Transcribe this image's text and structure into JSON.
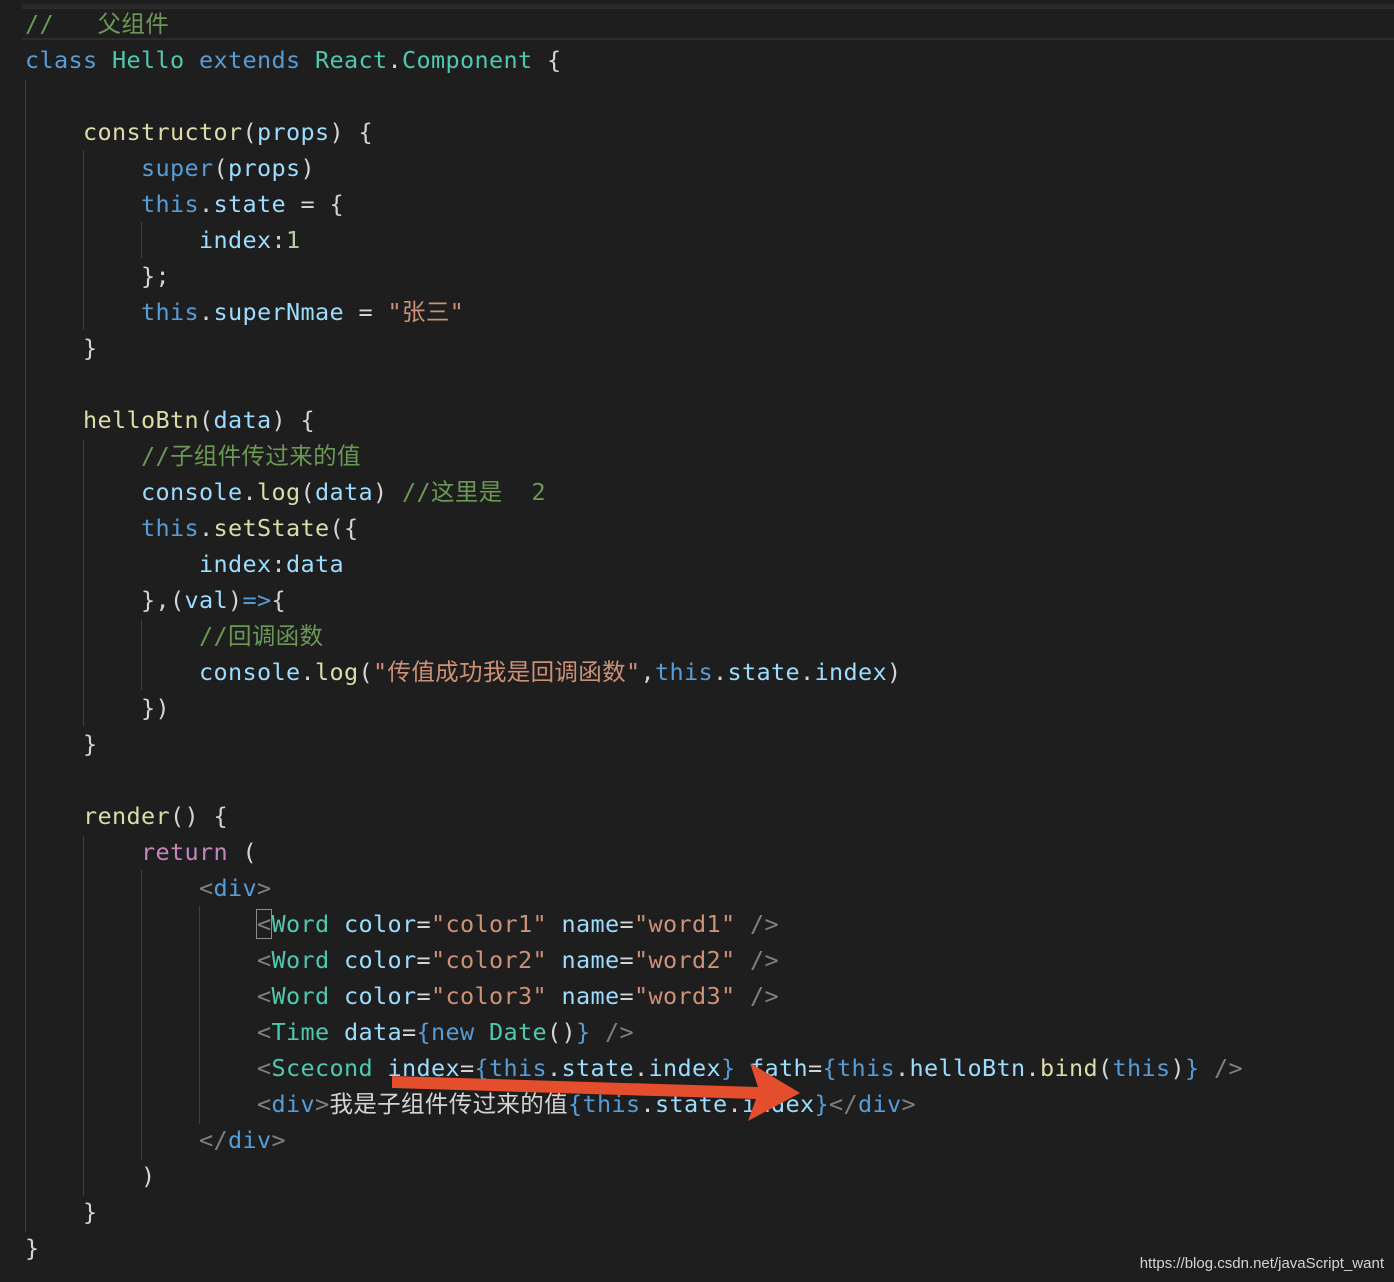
{
  "colors": {
    "background": "#1e1e1e",
    "arrow": "#e54e2c",
    "keyword": "#569cd6",
    "control": "#c586c0",
    "type": "#4ec9b0",
    "function": "#dcdcaa",
    "variable": "#9cdcfe",
    "string": "#ce9178",
    "number": "#b5cea8",
    "comment": "#6a9955",
    "plain": "#d4d4d4",
    "tag_punct": "#808080"
  },
  "watermark": "https://blog.csdn.net/javaScript_want",
  "annotation": {
    "icon": "red-arrow-icon"
  },
  "code_lines": [
    [
      [
        "c",
        "//   父组件"
      ]
    ],
    [
      [
        "k",
        "class"
      ],
      [
        "p",
        " "
      ],
      [
        "t",
        "Hello"
      ],
      [
        "p",
        " "
      ],
      [
        "k",
        "extends"
      ],
      [
        "p",
        " "
      ],
      [
        "t",
        "React"
      ],
      [
        "p",
        "."
      ],
      [
        "t",
        "Component"
      ],
      [
        "p",
        " {"
      ]
    ],
    [],
    [
      [
        "p",
        "    "
      ],
      [
        "f",
        "constructor"
      ],
      [
        "p",
        "("
      ],
      [
        "v",
        "props"
      ],
      [
        "p",
        ") {"
      ]
    ],
    [
      [
        "p",
        "        "
      ],
      [
        "k",
        "super"
      ],
      [
        "p",
        "("
      ],
      [
        "v",
        "props"
      ],
      [
        "p",
        ")"
      ]
    ],
    [
      [
        "p",
        "        "
      ],
      [
        "k",
        "this"
      ],
      [
        "p",
        "."
      ],
      [
        "v",
        "state"
      ],
      [
        "p",
        " = {"
      ]
    ],
    [
      [
        "p",
        "            "
      ],
      [
        "v",
        "index"
      ],
      [
        "p",
        ":"
      ],
      [
        "n",
        "1"
      ]
    ],
    [
      [
        "p",
        "        };"
      ]
    ],
    [
      [
        "p",
        "        "
      ],
      [
        "k",
        "this"
      ],
      [
        "p",
        "."
      ],
      [
        "v",
        "superNmae"
      ],
      [
        "p",
        " = "
      ],
      [
        "s",
        "\"张三\""
      ]
    ],
    [
      [
        "p",
        "    }"
      ]
    ],
    [],
    [
      [
        "p",
        "    "
      ],
      [
        "f",
        "helloBtn"
      ],
      [
        "p",
        "("
      ],
      [
        "v",
        "data"
      ],
      [
        "p",
        ") {"
      ]
    ],
    [
      [
        "p",
        "        "
      ],
      [
        "c",
        "//子组件传过来的值"
      ]
    ],
    [
      [
        "p",
        "        "
      ],
      [
        "v",
        "console"
      ],
      [
        "p",
        "."
      ],
      [
        "f",
        "log"
      ],
      [
        "p",
        "("
      ],
      [
        "v",
        "data"
      ],
      [
        "p",
        ") "
      ],
      [
        "c",
        "//这里是  2"
      ]
    ],
    [
      [
        "p",
        "        "
      ],
      [
        "k",
        "this"
      ],
      [
        "p",
        "."
      ],
      [
        "f",
        "setState"
      ],
      [
        "p",
        "({"
      ]
    ],
    [
      [
        "p",
        "            "
      ],
      [
        "v",
        "index"
      ],
      [
        "p",
        ":"
      ],
      [
        "v",
        "data"
      ]
    ],
    [
      [
        "p",
        "        },("
      ],
      [
        "v",
        "val"
      ],
      [
        "p",
        ")"
      ],
      [
        "k",
        "=>"
      ],
      [
        "p",
        "{"
      ]
    ],
    [
      [
        "p",
        "            "
      ],
      [
        "c",
        "//回调函数"
      ]
    ],
    [
      [
        "p",
        "            "
      ],
      [
        "v",
        "console"
      ],
      [
        "p",
        "."
      ],
      [
        "f",
        "log"
      ],
      [
        "p",
        "("
      ],
      [
        "s",
        "\"传值成功我是回调函数\""
      ],
      [
        "p",
        ","
      ],
      [
        "k",
        "this"
      ],
      [
        "p",
        "."
      ],
      [
        "v",
        "state"
      ],
      [
        "p",
        "."
      ],
      [
        "v",
        "index"
      ],
      [
        "p",
        ")"
      ]
    ],
    [
      [
        "p",
        "        })"
      ]
    ],
    [
      [
        "p",
        "    }"
      ]
    ],
    [],
    [
      [
        "p",
        "    "
      ],
      [
        "f",
        "render"
      ],
      [
        "p",
        "() {"
      ]
    ],
    [
      [
        "p",
        "        "
      ],
      [
        "r",
        "return"
      ],
      [
        "p",
        " ("
      ]
    ],
    [
      [
        "p",
        "            "
      ],
      [
        "g",
        "<"
      ],
      [
        "k",
        "div"
      ],
      [
        "g",
        ">"
      ]
    ],
    [
      [
        "p",
        "                "
      ],
      [
        "g",
        "<"
      ],
      [
        "t",
        "Word"
      ],
      [
        "p",
        " "
      ],
      [
        "v",
        "color"
      ],
      [
        "p",
        "="
      ],
      [
        "s",
        "\"color1\""
      ],
      [
        "p",
        " "
      ],
      [
        "v",
        "name"
      ],
      [
        "p",
        "="
      ],
      [
        "s",
        "\"word1\""
      ],
      [
        "p",
        " "
      ],
      [
        "g",
        "/>"
      ]
    ],
    [
      [
        "p",
        "                "
      ],
      [
        "g",
        "<"
      ],
      [
        "t",
        "Word"
      ],
      [
        "p",
        " "
      ],
      [
        "v",
        "color"
      ],
      [
        "p",
        "="
      ],
      [
        "s",
        "\"color2\""
      ],
      [
        "p",
        " "
      ],
      [
        "v",
        "name"
      ],
      [
        "p",
        "="
      ],
      [
        "s",
        "\"word2\""
      ],
      [
        "p",
        " "
      ],
      [
        "g",
        "/>"
      ]
    ],
    [
      [
        "p",
        "                "
      ],
      [
        "g",
        "<"
      ],
      [
        "t",
        "Word"
      ],
      [
        "p",
        " "
      ],
      [
        "v",
        "color"
      ],
      [
        "p",
        "="
      ],
      [
        "s",
        "\"color3\""
      ],
      [
        "p",
        " "
      ],
      [
        "v",
        "name"
      ],
      [
        "p",
        "="
      ],
      [
        "s",
        "\"word3\""
      ],
      [
        "p",
        " "
      ],
      [
        "g",
        "/>"
      ]
    ],
    [
      [
        "p",
        "                "
      ],
      [
        "g",
        "<"
      ],
      [
        "t",
        "Time"
      ],
      [
        "p",
        " "
      ],
      [
        "v",
        "data"
      ],
      [
        "p",
        "="
      ],
      [
        "k",
        "{"
      ],
      [
        "k",
        "new"
      ],
      [
        "p",
        " "
      ],
      [
        "t",
        "Date"
      ],
      [
        "p",
        "()"
      ],
      [
        "k",
        "}"
      ],
      [
        "p",
        " "
      ],
      [
        "g",
        "/>"
      ]
    ],
    [
      [
        "p",
        "                "
      ],
      [
        "g",
        "<"
      ],
      [
        "t",
        "Scecond"
      ],
      [
        "p",
        " "
      ],
      [
        "v",
        "index"
      ],
      [
        "p",
        "="
      ],
      [
        "k",
        "{"
      ],
      [
        "k",
        "this"
      ],
      [
        "p",
        "."
      ],
      [
        "v",
        "state"
      ],
      [
        "p",
        "."
      ],
      [
        "v",
        "index"
      ],
      [
        "k",
        "}"
      ],
      [
        "p",
        " "
      ],
      [
        "v",
        "fath"
      ],
      [
        "p",
        "="
      ],
      [
        "k",
        "{"
      ],
      [
        "k",
        "this"
      ],
      [
        "p",
        "."
      ],
      [
        "v",
        "helloBtn"
      ],
      [
        "p",
        "."
      ],
      [
        "f",
        "bind"
      ],
      [
        "p",
        "("
      ],
      [
        "k",
        "this"
      ],
      [
        "p",
        ")"
      ],
      [
        "k",
        "}"
      ],
      [
        "p",
        " "
      ],
      [
        "g",
        "/>"
      ]
    ],
    [
      [
        "p",
        "                "
      ],
      [
        "g",
        "<"
      ],
      [
        "k",
        "div"
      ],
      [
        "g",
        ">"
      ],
      [
        "p",
        "我是子组件传过来的值"
      ],
      [
        "k",
        "{"
      ],
      [
        "k",
        "this"
      ],
      [
        "p",
        "."
      ],
      [
        "v",
        "state"
      ],
      [
        "p",
        "."
      ],
      [
        "v",
        "index"
      ],
      [
        "k",
        "}"
      ],
      [
        "g",
        "</"
      ],
      [
        "k",
        "div"
      ],
      [
        "g",
        ">"
      ]
    ],
    [
      [
        "p",
        "            "
      ],
      [
        "g",
        "</"
      ],
      [
        "k",
        "div"
      ],
      [
        "g",
        ">"
      ]
    ],
    [
      [
        "p",
        "        )"
      ]
    ],
    [
      [
        "p",
        "    }"
      ]
    ],
    [
      [
        "p",
        "}"
      ]
    ]
  ]
}
